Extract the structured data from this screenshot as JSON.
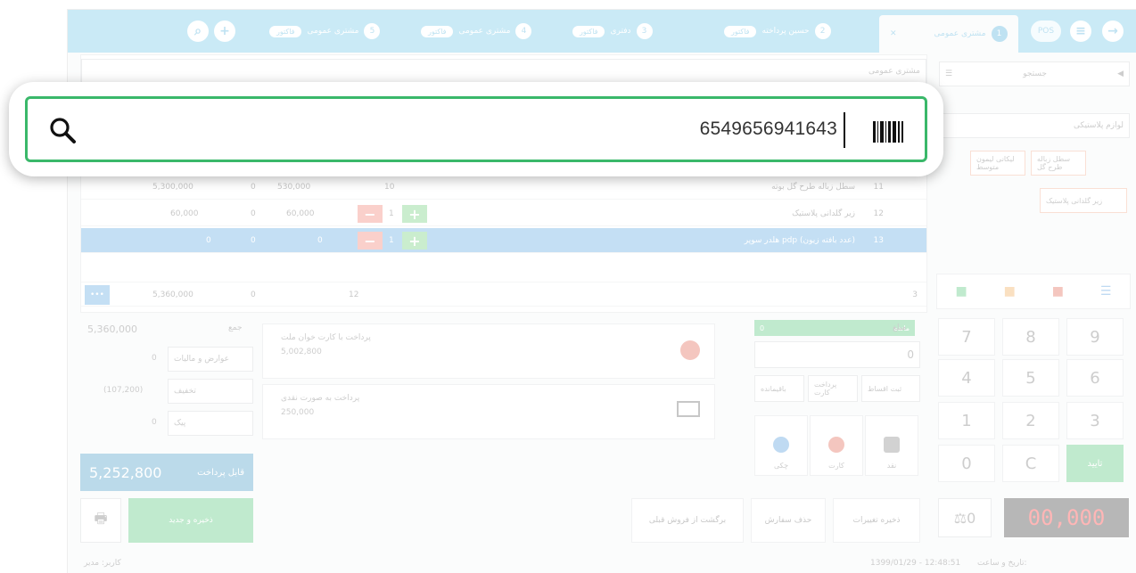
{
  "tabs": {
    "active": {
      "num": "1",
      "label": "مشتری عمومی"
    },
    "others": [
      {
        "num": "2",
        "label": "حسین پرداخته",
        "badge": "فاکتور"
      },
      {
        "num": "3",
        "label": "دفتری",
        "badge": "فاکتور"
      },
      {
        "num": "4",
        "label": "مشتری عمومی",
        "badge": "فاکتور"
      },
      {
        "num": "5",
        "label": "مشتری عمومی",
        "badge": "فاکتور"
      }
    ],
    "tool_label": "POS"
  },
  "left_top": {
    "customer_label": "مشتری عمومی",
    "search_placeholder": "جستجو",
    "category_placeholder": "لوازم پلاستیکی",
    "product_buttons": [
      "لیکانی لیمون متوسط",
      "سطل زباله طرح گل",
      "زیر گلدانی پلاستیک"
    ]
  },
  "items": [
    {
      "idx": "11",
      "name": "سطل زباله طرح گل بوته",
      "qty": "10",
      "price": "530,000",
      "discount": "0",
      "total": "5,300,000"
    },
    {
      "idx": "12",
      "name": "زیر گلدانی پلاستیک",
      "qty": "1",
      "price": "60,000",
      "discount": "0",
      "total": "60,000"
    },
    {
      "idx": "13",
      "name": "هلدر سوپر pdp (عدد بافته زیون)",
      "qty": "1",
      "price": "0",
      "discount": "0",
      "total": "0"
    }
  ],
  "totals_row": {
    "count": "3",
    "qty": "12",
    "discount": "0",
    "total": "5,360,000"
  },
  "keypad": [
    "7",
    "8",
    "9",
    "4",
    "5",
    "6",
    "1",
    "2",
    "3",
    "0",
    "C",
    "تایید"
  ],
  "payment_entry": {
    "amount_label": "مبلغ",
    "remain_label": "مانده",
    "remain_value": "0",
    "amount_value": "0",
    "btn_rest": "باقیمانده",
    "btn_card": "پرداخت کارت",
    "btn_pose": "ثبت اقساط"
  },
  "pay_tiles": [
    "نقد",
    "کارت",
    "چکی"
  ],
  "payments": [
    {
      "title": "پرداخت با کارت خوان ملت",
      "value": "5,002,800"
    },
    {
      "title": "پرداخت به صورت نقدی",
      "value": "250,000"
    }
  ],
  "summary": {
    "sum_label": "جمع",
    "sum_value": "5,360,000",
    "tax_label": "عوارض و مالیات",
    "tax_value": "0",
    "discount_label": "تخفیف",
    "discount_value": "(107,200)",
    "tip_label": "پیک",
    "tip_value": "0",
    "payable_label": "قابل پرداخت",
    "payable_value": "5,252,800"
  },
  "actions": {
    "save_new": "ذخیره و جدید",
    "save_changes": "ذخیره تغییرات",
    "cancel_order": "حذف سفارش",
    "returns": "برگشت از فروش قبلی"
  },
  "display": {
    "amount": "00,000",
    "scale": "0"
  },
  "footer": {
    "datetime_label": "تاریخ و ساعت:",
    "datetime": "1399/01/29 - 12:48:51",
    "user": "کاربر: مدیر"
  },
  "search": {
    "value": "6549656941643"
  }
}
